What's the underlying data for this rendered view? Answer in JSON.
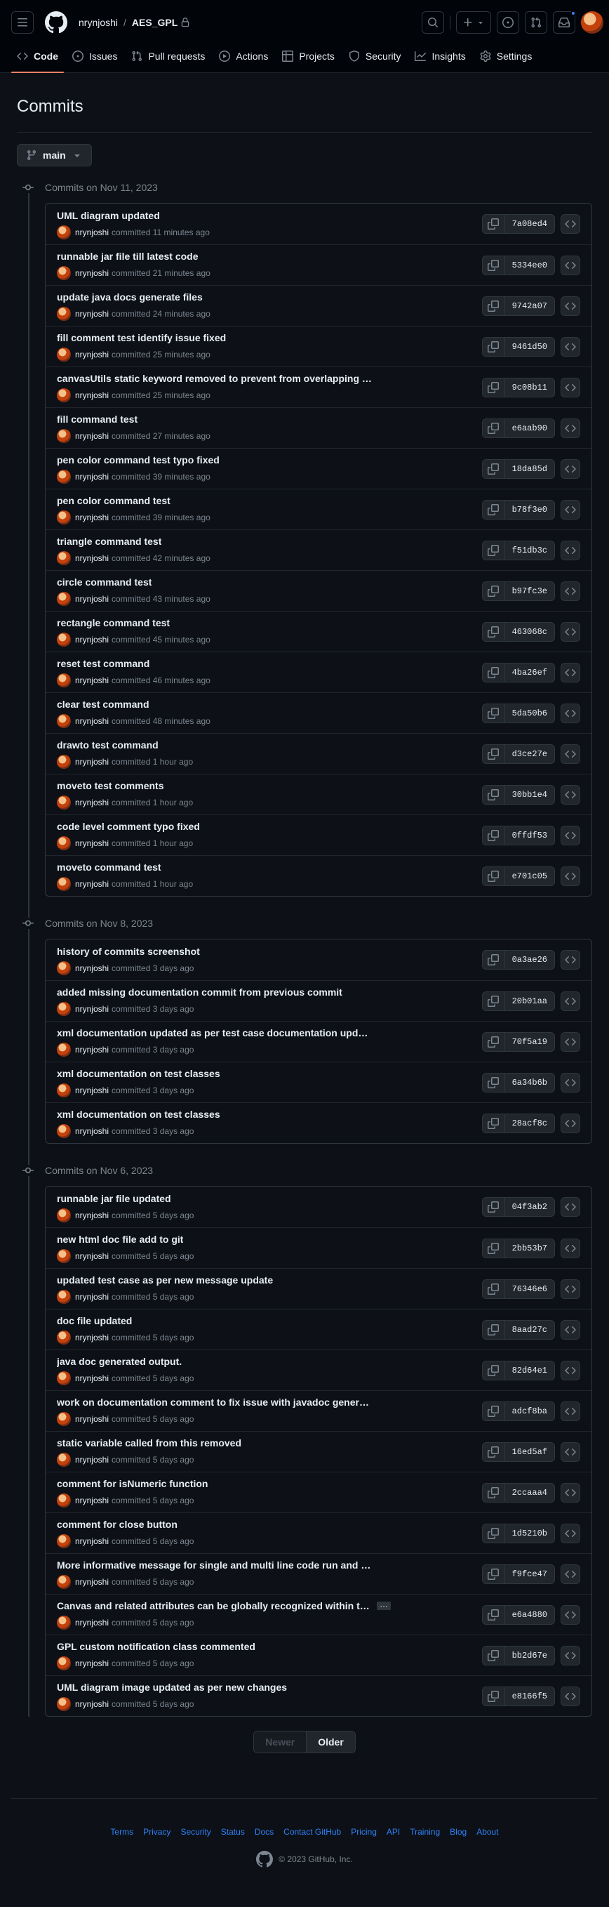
{
  "header": {
    "owner": "nrynjoshi",
    "separator": "/",
    "repo": "AES_GPL"
  },
  "tabs": [
    {
      "label": "Code",
      "icon": "code-icon"
    },
    {
      "label": "Issues",
      "icon": "issue-opened-icon"
    },
    {
      "label": "Pull requests",
      "icon": "git-pull-request-icon"
    },
    {
      "label": "Actions",
      "icon": "play-icon"
    },
    {
      "label": "Projects",
      "icon": "table-icon"
    },
    {
      "label": "Security",
      "icon": "shield-icon"
    },
    {
      "label": "Insights",
      "icon": "graph-icon"
    },
    {
      "label": "Settings",
      "icon": "gear-icon"
    }
  ],
  "page": {
    "title": "Commits",
    "branch": "main"
  },
  "commit_verb": "committed",
  "groups": [
    {
      "heading": "Commits on Nov 11, 2023",
      "commits": [
        {
          "msg": "UML diagram updated",
          "author": "nrynjoshi",
          "time": "11 minutes ago",
          "sha": "7a08ed4"
        },
        {
          "msg": "runnable jar file till latest code",
          "author": "nrynjoshi",
          "time": "21 minutes ago",
          "sha": "5334ee0"
        },
        {
          "msg": "update java docs generate files",
          "author": "nrynjoshi",
          "time": "24 minutes ago",
          "sha": "9742a07"
        },
        {
          "msg": "fill comment test identify issue fixed",
          "author": "nrynjoshi",
          "time": "25 minutes ago",
          "sha": "9461d50"
        },
        {
          "msg": "canvasUtils static keyword removed to prevent from overlapping commands",
          "author": "nrynjoshi",
          "time": "25 minutes ago",
          "sha": "9c08b11"
        },
        {
          "msg": "fill command test",
          "author": "nrynjoshi",
          "time": "27 minutes ago",
          "sha": "e6aab90"
        },
        {
          "msg": "pen color command test typo fixed",
          "author": "nrynjoshi",
          "time": "39 minutes ago",
          "sha": "18da85d"
        },
        {
          "msg": "pen color command test",
          "author": "nrynjoshi",
          "time": "39 minutes ago",
          "sha": "b78f3e0"
        },
        {
          "msg": "triangle command test",
          "author": "nrynjoshi",
          "time": "42 minutes ago",
          "sha": "f51db3c"
        },
        {
          "msg": "circle command test",
          "author": "nrynjoshi",
          "time": "43 minutes ago",
          "sha": "b97fc3e"
        },
        {
          "msg": "rectangle command test",
          "author": "nrynjoshi",
          "time": "45 minutes ago",
          "sha": "463068c"
        },
        {
          "msg": "reset test command",
          "author": "nrynjoshi",
          "time": "46 minutes ago",
          "sha": "4ba26ef"
        },
        {
          "msg": "clear test command",
          "author": "nrynjoshi",
          "time": "48 minutes ago",
          "sha": "5da50b6"
        },
        {
          "msg": "drawto test command",
          "author": "nrynjoshi",
          "time": "1 hour ago",
          "sha": "d3ce27e"
        },
        {
          "msg": "moveto test comments",
          "author": "nrynjoshi",
          "time": "1 hour ago",
          "sha": "30bb1e4"
        },
        {
          "msg": "code level comment typo fixed",
          "author": "nrynjoshi",
          "time": "1 hour ago",
          "sha": "0ffdf53"
        },
        {
          "msg": "moveto command test",
          "author": "nrynjoshi",
          "time": "1 hour ago",
          "sha": "e701c05"
        }
      ]
    },
    {
      "heading": "Commits on Nov 8, 2023",
      "commits": [
        {
          "msg": "history of commits screenshot",
          "author": "nrynjoshi",
          "time": "3 days ago",
          "sha": "0a3ae26"
        },
        {
          "msg": "added missing documentation commit from previous commit",
          "author": "nrynjoshi",
          "time": "3 days ago",
          "sha": "20b01aa"
        },
        {
          "msg": "xml documentation updated as per test case documentation updated",
          "author": "nrynjoshi",
          "time": "3 days ago",
          "sha": "70f5a19"
        },
        {
          "msg": "xml documentation on test classes",
          "author": "nrynjoshi",
          "time": "3 days ago",
          "sha": "6a34b6b"
        },
        {
          "msg": "xml documentation on test classes",
          "author": "nrynjoshi",
          "time": "3 days ago",
          "sha": "28acf8c"
        }
      ]
    },
    {
      "heading": "Commits on Nov 6, 2023",
      "commits": [
        {
          "msg": "runnable jar file updated",
          "author": "nrynjoshi",
          "time": "5 days ago",
          "sha": "04f3ab2"
        },
        {
          "msg": "new html doc file add to git",
          "author": "nrynjoshi",
          "time": "5 days ago",
          "sha": "2bb53b7"
        },
        {
          "msg": "updated test case as per new message update",
          "author": "nrynjoshi",
          "time": "5 days ago",
          "sha": "76346e6"
        },
        {
          "msg": "doc file updated",
          "author": "nrynjoshi",
          "time": "5 days ago",
          "sha": "8aad27c"
        },
        {
          "msg": "java doc generated output.",
          "author": "nrynjoshi",
          "time": "5 days ago",
          "sha": "82d64e1"
        },
        {
          "msg": "work on documentation comment to fix issue with javadoc generate.",
          "author": "nrynjoshi",
          "time": "5 days ago",
          "sha": "adcf8ba"
        },
        {
          "msg": "static variable called from this removed",
          "author": "nrynjoshi",
          "time": "5 days ago",
          "sha": "16ed5af"
        },
        {
          "msg": "comment for isNumeric function",
          "author": "nrynjoshi",
          "time": "5 days ago",
          "sha": "2ccaaa4"
        },
        {
          "msg": "comment for close button",
          "author": "nrynjoshi",
          "time": "5 days ago",
          "sha": "1d5210b"
        },
        {
          "msg": "More informative message for single and multi line code run and validate",
          "author": "nrynjoshi",
          "time": "5 days ago",
          "sha": "f9fce47"
        },
        {
          "msg": "Canvas and related attributes can be globally recognized within the a…",
          "author": "nrynjoshi",
          "time": "5 days ago",
          "sha": "e6a4880",
          "truncated": true,
          "expand": "…"
        },
        {
          "msg": "GPL custom notification class commented",
          "author": "nrynjoshi",
          "time": "5 days ago",
          "sha": "bb2d67e"
        },
        {
          "msg": "UML diagram image updated as per new changes",
          "author": "nrynjoshi",
          "time": "5 days ago",
          "sha": "e8166f5"
        }
      ]
    }
  ],
  "pagination": {
    "newer": "Newer",
    "older": "Older"
  },
  "footer": {
    "links": [
      "Terms",
      "Privacy",
      "Security",
      "Status",
      "Docs",
      "Contact GitHub",
      "Pricing",
      "API",
      "Training",
      "Blog",
      "About"
    ],
    "copyright": "© 2023 GitHub, Inc."
  },
  "colors": {
    "accent": "#2f81f7",
    "tab_underline": "#f78166",
    "background": "#0d1117"
  }
}
